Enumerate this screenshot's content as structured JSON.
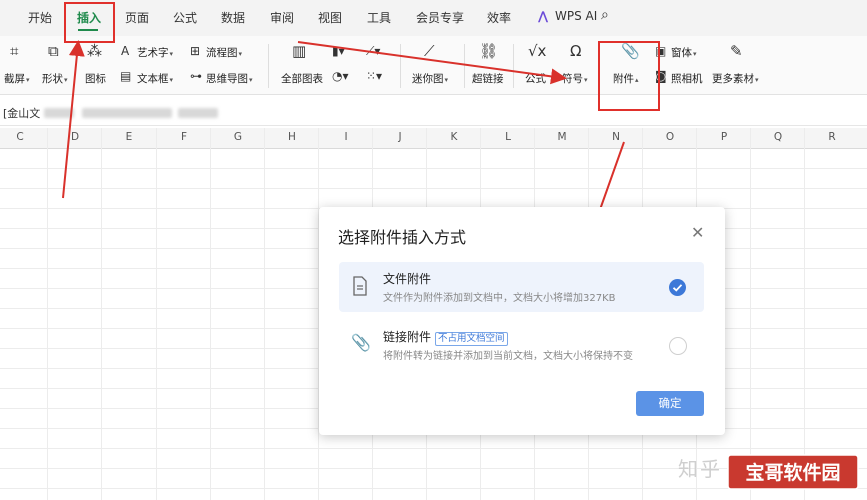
{
  "menubar": {
    "tabs": [
      "开始",
      "插入",
      "页面",
      "公式",
      "数据",
      "审阅",
      "视图",
      "工具",
      "会员专享",
      "效率"
    ],
    "active_tab": "插入",
    "wps_ai": "WPS AI",
    "accent_color": "#1f8a4c"
  },
  "ribbon": {
    "screenshot": "截屏",
    "shapes": "形状",
    "icons": "图标",
    "wordart": "艺术字",
    "textbox": "文本框",
    "flowchart": "流程图",
    "mindmap": "思维导图",
    "all_charts": "全部图表",
    "sparkline": "迷你图",
    "hyperlink": "超链接",
    "formula": "公式",
    "symbol": "符号",
    "attachment": "附件",
    "window": "窗体",
    "camera": "照相机",
    "more_material": "更多素材"
  },
  "formula_bar": {
    "name_box": "[金山文"
  },
  "columns": [
    "C",
    "D",
    "E",
    "F",
    "G",
    "H",
    "I",
    "J",
    "K",
    "L",
    "M",
    "N",
    "O",
    "P",
    "Q",
    "R"
  ],
  "dialog": {
    "title": "选择附件插入方式",
    "close_icon": "close-icon",
    "option1": {
      "title": "文件附件",
      "desc": "文件作为附件添加到文档中，文档大小将增加327KB",
      "selected": true
    },
    "option2": {
      "title": "链接附件",
      "badge": "不占用文档空间",
      "desc": "将附件转为链接并添加到当前文档，文档大小将保持不变",
      "selected": false
    },
    "ok_label": "确定",
    "ok_color": "#5b93e6"
  },
  "watermark": {
    "faint": "知乎",
    "badge": "宝哥软件园"
  }
}
